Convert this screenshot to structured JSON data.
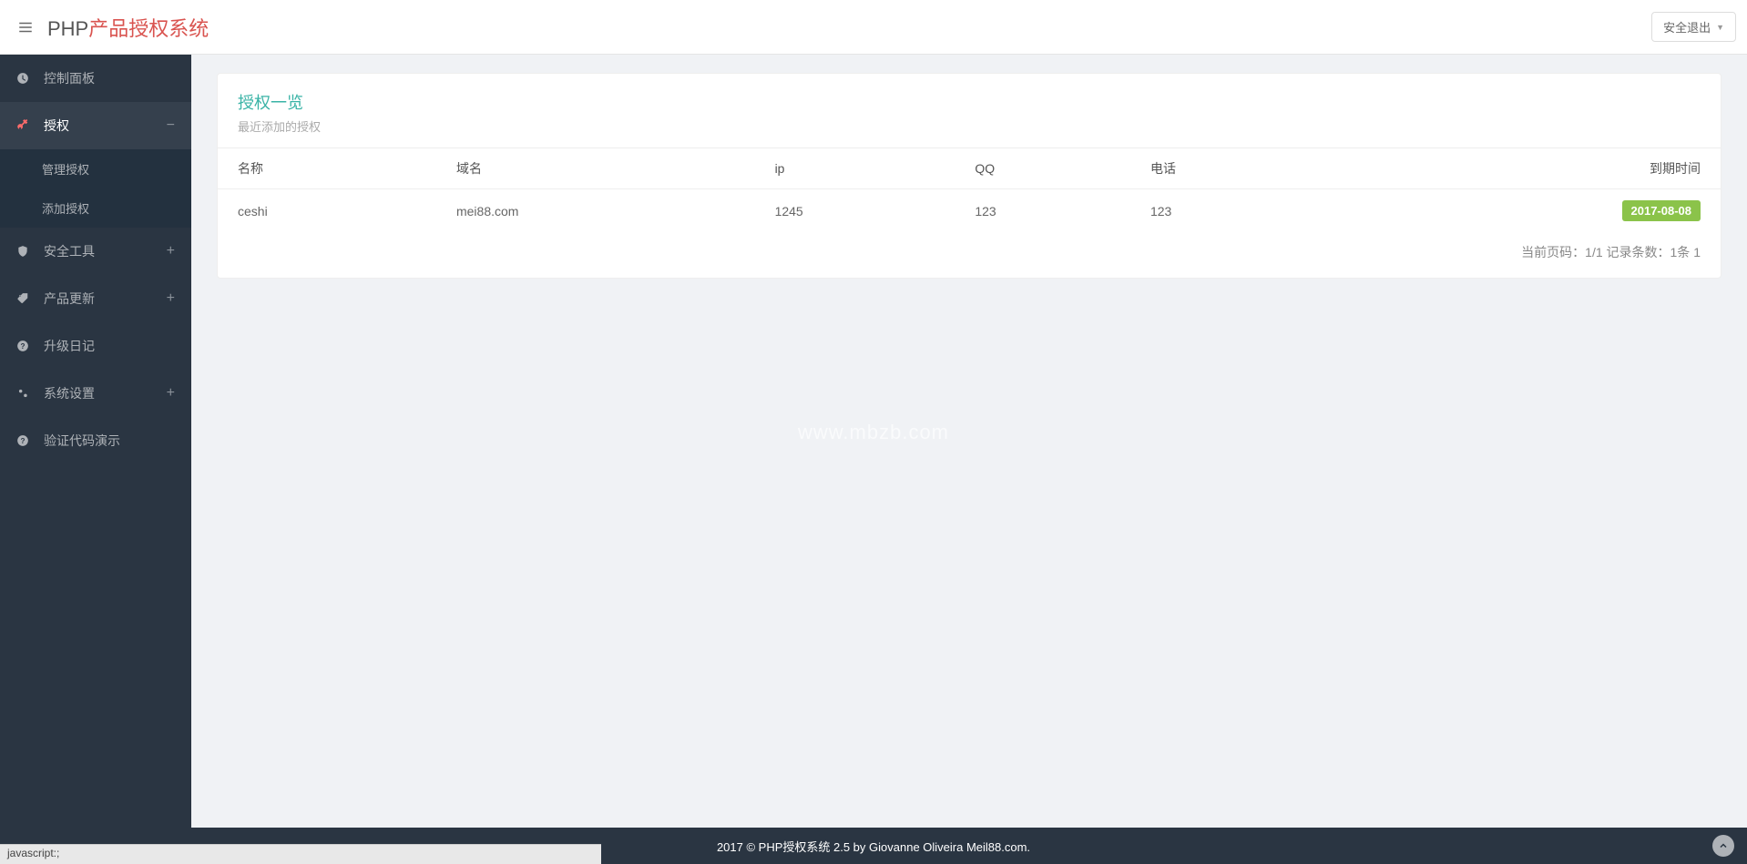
{
  "header": {
    "brand_prefix": "PHP",
    "brand_suffix": "产品授权系统",
    "logout_label": "安全退出"
  },
  "sidebar": {
    "items": [
      {
        "label": "控制面板",
        "icon": "dashboard",
        "expandable": false
      },
      {
        "label": "授权",
        "icon": "key",
        "expandable": true,
        "active": true,
        "children": [
          {
            "label": "管理授权"
          },
          {
            "label": "添加授权"
          }
        ]
      },
      {
        "label": "安全工具",
        "icon": "shield",
        "expandable": true
      },
      {
        "label": "产品更新",
        "icon": "tag",
        "expandable": true
      },
      {
        "label": "升级日记",
        "icon": "help",
        "expandable": false
      },
      {
        "label": "系统设置",
        "icon": "cogs",
        "expandable": true
      },
      {
        "label": "验证代码演示",
        "icon": "help",
        "expandable": false
      }
    ]
  },
  "panel": {
    "title": "授权一览",
    "subtitle": "最近添加的授权"
  },
  "table": {
    "columns": [
      "名称",
      "域名",
      "ip",
      "QQ",
      "电话",
      "到期时间"
    ],
    "rows": [
      {
        "name": "ceshi",
        "domain": "mei88.com",
        "ip": "1245",
        "qq": "123",
        "phone": "123",
        "expire": "2017-08-08"
      }
    ]
  },
  "pagination": {
    "text": "当前页码：1/1 记录条数：1条 1"
  },
  "footer": {
    "text": "2017 © PHP授权系统 2.5 by Giovanne Oliveira Meil88.com."
  },
  "statusbar": {
    "text": "javascript:;"
  },
  "watermark": "www.mbzb.com"
}
